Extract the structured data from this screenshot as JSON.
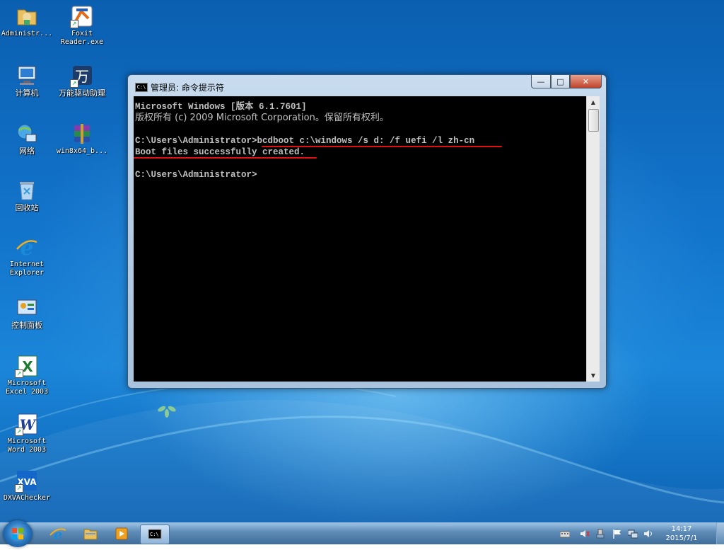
{
  "desktop_icons": [
    {
      "name": "administrator-folder",
      "label": "Administr...",
      "font": "mono"
    },
    {
      "name": "foxit-reader",
      "label": "Foxit\nReader.exe",
      "font": "mono"
    },
    {
      "name": "computer",
      "label": "计算机",
      "font": "cn"
    },
    {
      "name": "driver-assistant",
      "label": "万能驱动助理",
      "font": "cn"
    },
    {
      "name": "network",
      "label": "网络",
      "font": "cn"
    },
    {
      "name": "win8x64-archive",
      "label": "win8x64_b...",
      "font": "mono"
    },
    {
      "name": "recycle-bin",
      "label": "回收站",
      "font": "cn"
    },
    {
      "name": "internet-explorer",
      "label": "Internet\nExplorer",
      "font": "mono"
    },
    {
      "name": "control-panel",
      "label": "控制面板",
      "font": "cn"
    },
    {
      "name": "excel-2003",
      "label": "Microsoft\nExcel 2003",
      "font": "mono"
    },
    {
      "name": "word-2003",
      "label": "Microsoft\nWord 2003",
      "font": "mono"
    },
    {
      "name": "dxvachecker",
      "label": "DXVAChecker",
      "font": "mono"
    }
  ],
  "cmd_window": {
    "title": "管理员: 命令提示符",
    "icon_text": "C:\\",
    "buttons": {
      "minimize": "—",
      "maximize": "□",
      "close": "✕"
    },
    "lines": [
      "Microsoft Windows [版本 6.1.7601]",
      "版权所有 (c) 2009 Microsoft Corporation。保留所有权利。",
      "",
      "C:\\Users\\Administrator>bcdboot c:\\windows /s d: /f uefi /l zh-cn",
      "Boot files successfully created.",
      "",
      "C:\\Users\\Administrator>"
    ],
    "annotation_color": "#e01010"
  },
  "taskbar": {
    "pinned": [
      "internet-explorer",
      "windows-explorer",
      "media-player",
      "command-prompt"
    ],
    "clock_time": "14:17",
    "clock_date": "2015/7/1"
  }
}
